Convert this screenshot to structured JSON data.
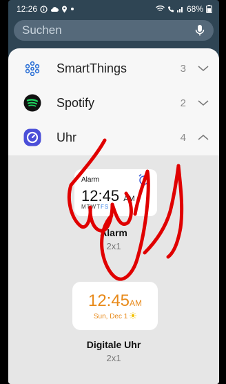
{
  "status": {
    "time": "12:26",
    "battery": "68%",
    "icons": [
      "info-icon",
      "cloud-icon",
      "location-icon",
      "dot-icon",
      "wifi-icon",
      "call-icon",
      "signal-icon",
      "battery-icon"
    ]
  },
  "search": {
    "placeholder": "Suchen",
    "icon": "microphone-icon"
  },
  "apps": [
    {
      "name": "SmartThings",
      "count": "3",
      "icon": "smartthings-icon",
      "expanded": false
    },
    {
      "name": "Spotify",
      "count": "2",
      "icon": "spotify-icon",
      "expanded": false
    },
    {
      "name": "Uhr",
      "count": "4",
      "icon": "clock-app-icon",
      "expanded": true
    }
  ],
  "widgets": [
    {
      "preview": {
        "title": "Alarm",
        "time": "12:45",
        "ampm": "AM",
        "days_dark": "MTWT",
        "days_blue": "FS",
        "icon": "alarm-clock-icon"
      },
      "name": "Alarm",
      "size": "2x1"
    },
    {
      "preview": {
        "time": "12:45",
        "ampm": "AM",
        "date": "Sun, Dec 1",
        "icon": "sun-icon"
      },
      "name": "Digitale Uhr",
      "size": "2x1"
    }
  ],
  "colors": {
    "background": "#2f4554",
    "searchbar": "#55697a",
    "panel": "#f7f7f7",
    "widget_area": "#e6e6e6",
    "accent_orange": "#e88a1a",
    "accent_blue": "#2e7be6",
    "spotify_green": "#1ed760",
    "clock_purple": "#4b4fd8",
    "scribble_red": "#e00000"
  }
}
